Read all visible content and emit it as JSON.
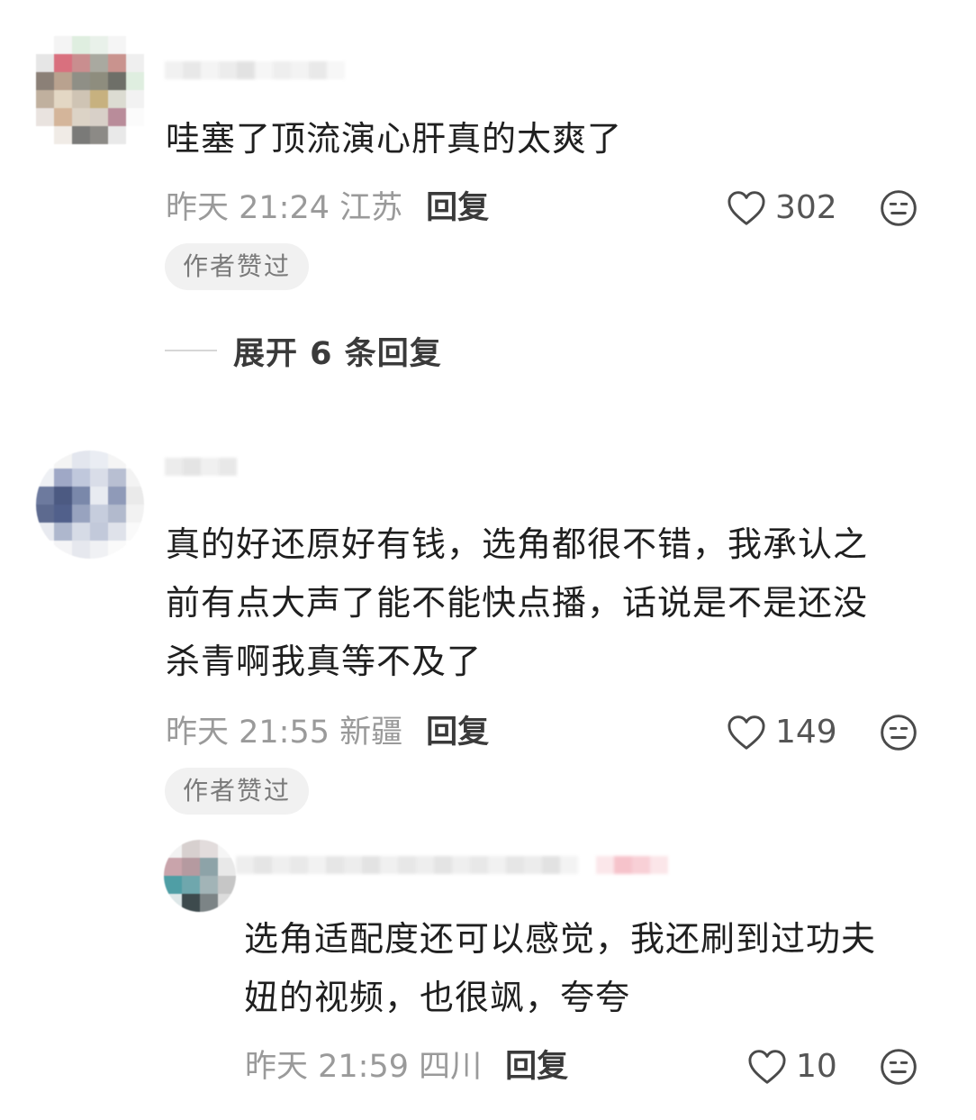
{
  "comments": [
    {
      "content": "哇塞了顶流演心肝真的太爽了",
      "time": "昨天 21:24 江苏",
      "reply_label": "回复",
      "likes": "302",
      "author_badge": "作者赞过",
      "expand_label": "展开 6 条回复"
    },
    {
      "content_lines": [
        "真的好还原好有钱，选角都很不错，我承认之",
        "前有点大声了能不能快点播，话说是不是还没",
        "杀青啊我真等不及了"
      ],
      "time": "昨天 21:55 新疆",
      "reply_label": "回复",
      "likes": "149",
      "author_badge": "作者赞过"
    },
    {
      "content_lines": [
        "选角适配度还可以感觉，我还刷到过功夫",
        "妞的视频，也很飒，夸夸"
      ],
      "time": "昨天 21:59 四川",
      "reply_label": "回复",
      "likes": "10"
    }
  ],
  "icons": {
    "like": "heart-outline-icon",
    "dislike": "meh-face-icon"
  },
  "colors": {
    "text_primary": "#1f1f1f",
    "text_secondary": "#9a9a9a",
    "badge_bg": "#f1f1f1"
  }
}
